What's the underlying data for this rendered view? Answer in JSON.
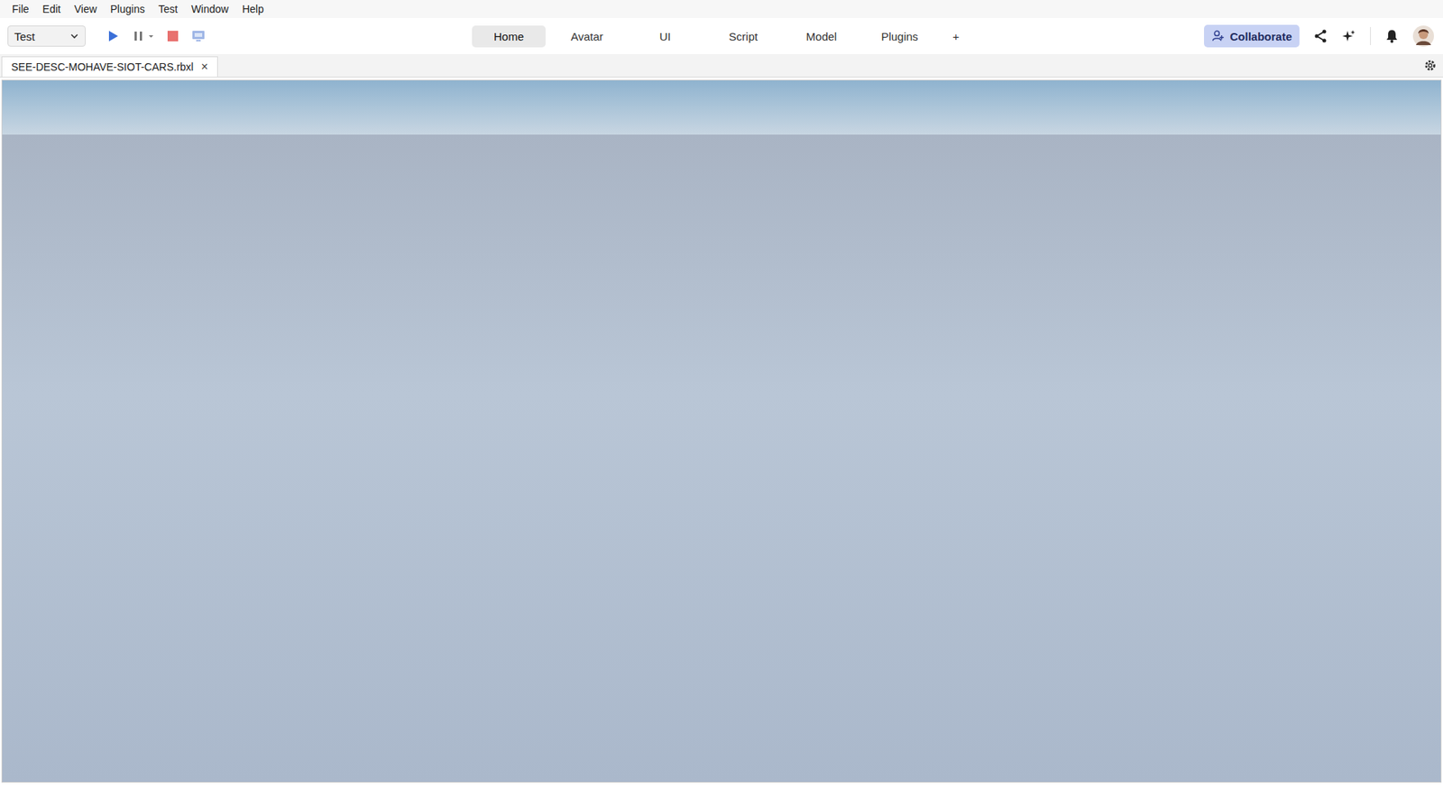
{
  "menu": [
    "File",
    "Edit",
    "View",
    "Plugins",
    "Test",
    "Window",
    "Help"
  ],
  "toolbar": {
    "mode_dropdown": "Test"
  },
  "ribbon_tabs": [
    {
      "label": "Home",
      "selected": true
    },
    {
      "label": "Avatar",
      "selected": false
    },
    {
      "label": "UI",
      "selected": false
    },
    {
      "label": "Script",
      "selected": false
    },
    {
      "label": "Model",
      "selected": false
    },
    {
      "label": "Plugins",
      "selected": false
    }
  ],
  "add_tab": "+",
  "collaborate": "Collaborate",
  "document_tabs": [
    {
      "label": "SEE-DESC-MOHAVE-SIOT-CARS.rbxl",
      "selected": true,
      "close": "×"
    }
  ]
}
